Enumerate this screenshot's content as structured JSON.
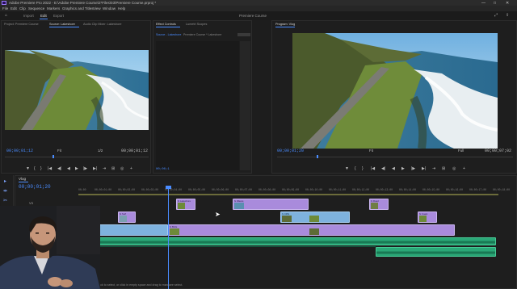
{
  "window": {
    "title": "Adobe Premiere Pro 2022 - E:\\Adobe Premiere Course\\2*Files\\03\\Premiere Course.prproj *",
    "controls": [
      "—",
      "□",
      "✕"
    ]
  },
  "menu": [
    "File",
    "Edit",
    "Clip",
    "Sequence",
    "Markers",
    "Graphics and Titles",
    "View",
    "Window",
    "Help"
  ],
  "workspaces": {
    "tabs": [
      "Import",
      "Edit",
      "Export"
    ],
    "active": "Edit",
    "project": "Premiere Course"
  },
  "source_panel": {
    "tabs": [
      "Project: Premiere Course",
      "Source: Lakeshore",
      "Audio Clip Mixer: Lakeshore"
    ],
    "active": 1,
    "timecode_left": "00;00;01;12",
    "fit": "Fit",
    "fraction": "1/2",
    "timecode_right": "00;00;01;12",
    "controls": [
      "▼",
      "{",
      "}",
      "|◀",
      "◀|",
      "◀",
      "▶",
      "|▶",
      "▶|",
      "⇥",
      "⊞",
      "◎",
      "+"
    ]
  },
  "effects_panel": {
    "tabs": [
      "Effect Controls",
      "Lumetri Scopes"
    ],
    "active": 0,
    "source_label": "Source - Lakeshore",
    "clip_label": "Premiere Course * Lakeshore",
    "timecode": "00;00;1"
  },
  "program_panel": {
    "title": "Program: Vlog",
    "timecode_left": "00;00;01;20",
    "fit": "Fit",
    "fraction": "Full",
    "timecode_right": "00;00;07;02",
    "controls": [
      "▼",
      "{",
      "}",
      "|◀",
      "◀|",
      "◀",
      "▶",
      "|▶",
      "▶|",
      "⇥",
      "⊞",
      "◎",
      "+"
    ]
  },
  "timeline": {
    "tab": "Vlog",
    "timecode": "00;00;01;20",
    "ruler": [
      "00;00",
      "00;00;01;00",
      "00;00;02;00",
      "00;00;03;00",
      "00;00;04;00",
      "00;00;05;00",
      "00;00;06;00",
      "00;00;07;00",
      "00;00;08;00",
      "00;00;09;00",
      "00;00;10;00",
      "00;00;11;00",
      "00;00;12;00",
      "00;00;13;00",
      "00;00;14;00",
      "00;00;15;00",
      "00;00;16;00",
      "00;00;17;00",
      "00;00;18;00"
    ],
    "tracks": [
      "V3",
      "V2",
      "V1",
      "A1",
      "A2",
      "A3"
    ],
    "status": "Click to select, or click in empty space and drag to marquee select.",
    "clip_names": [
      "fx Lakeshore",
      "fx Waves",
      "fx Road",
      "fx Surf",
      "fx Cliffs",
      "fx Coast",
      "fx Beach",
      "fx Birds",
      "fx Rocks"
    ]
  },
  "tools": [
    "▸",
    "⇹",
    "✂",
    "↔",
    "✎",
    "✋",
    "T"
  ],
  "colors": {
    "accent": "#4a8cff",
    "video_clip_purple": "#a98bdc",
    "video_clip_blue": "#7eb2de",
    "audio_clip_green": "#2aa877",
    "playhead": "#4a8cff"
  }
}
